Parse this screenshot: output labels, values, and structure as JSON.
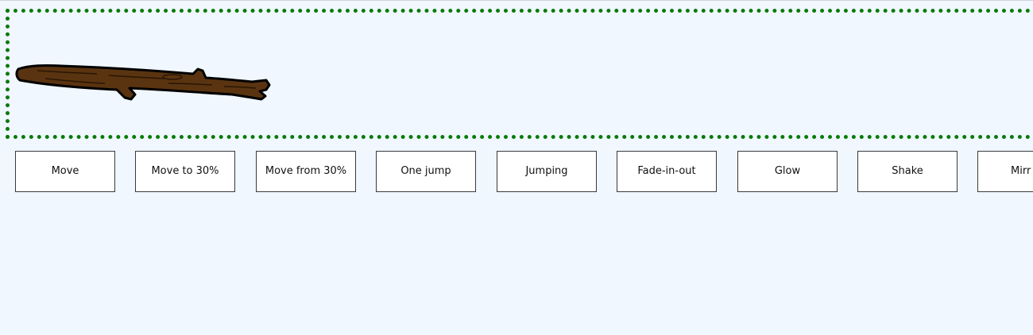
{
  "stage": {
    "border_color": "#0b7a0b",
    "background": "#f0f7ff",
    "image_name": "stick-icon"
  },
  "buttons": [
    {
      "label": "Move"
    },
    {
      "label": "Move to 30%"
    },
    {
      "label": "Move from 30%"
    },
    {
      "label": "One jump"
    },
    {
      "label": "Jumping"
    },
    {
      "label": "Fade-in-out"
    },
    {
      "label": "Glow"
    },
    {
      "label": "Shake"
    },
    {
      "label": "Mirr"
    }
  ]
}
